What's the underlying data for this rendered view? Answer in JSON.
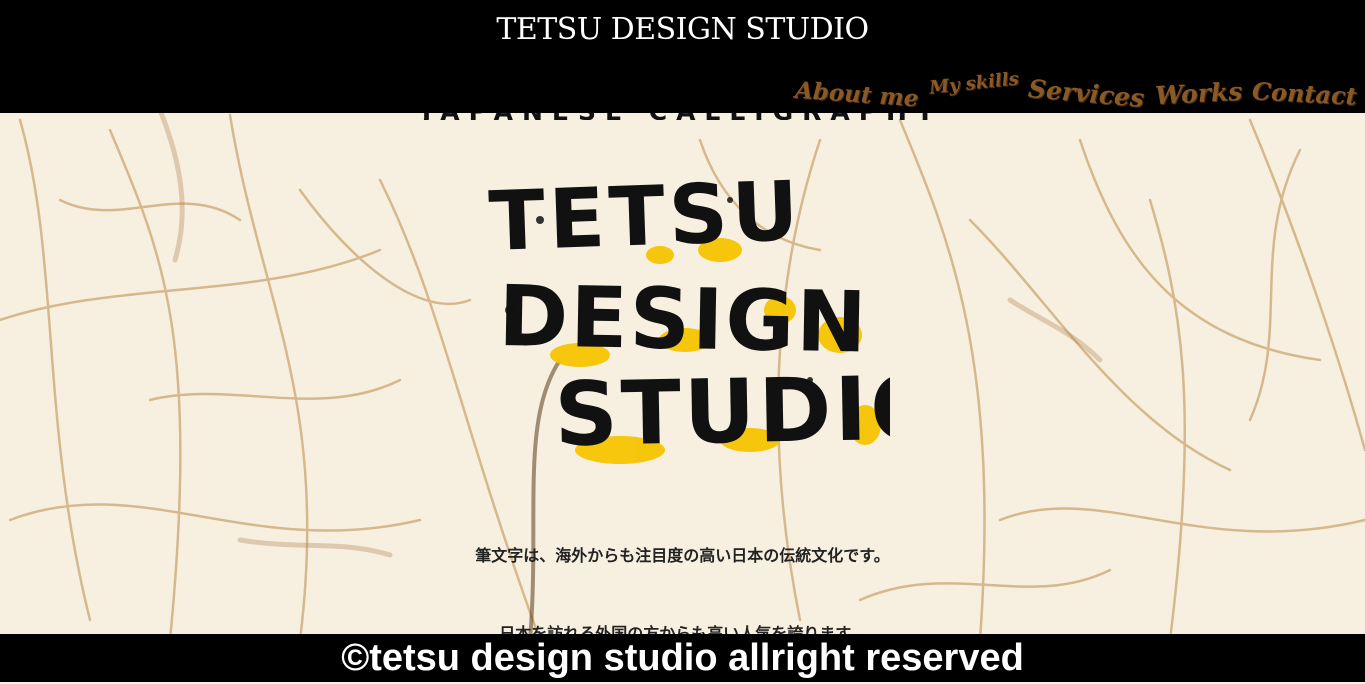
{
  "header": {
    "site_title": "TETSU DESIGN STUDIO",
    "nav": [
      {
        "label": "About me"
      },
      {
        "label": "My skills"
      },
      {
        "label": "Services"
      },
      {
        "label": "Works"
      },
      {
        "label": "Contact"
      }
    ]
  },
  "hero": {
    "partial_heading": "JAPANESE CALLIGRAPHY",
    "logo_alt": "TETSU DESIGN STUDIO",
    "logo_lines": [
      "TETSU",
      "DESIGN",
      "STUDIO"
    ]
  },
  "intro": {
    "p1": "筆文字は、海外からも注目度の高い日本の伝統文化です。",
    "p2": "日本を訪れる外国の方からも高い人気を誇ります。"
  },
  "footer": {
    "copyright": "©tetsu design studio allright reserved"
  },
  "colors": {
    "paper": "#f7f0e1",
    "fiber": "#c9a16a",
    "ink": "#111111",
    "accent_yellow": "#f5c400",
    "nav_brown": "#8a5a26"
  }
}
